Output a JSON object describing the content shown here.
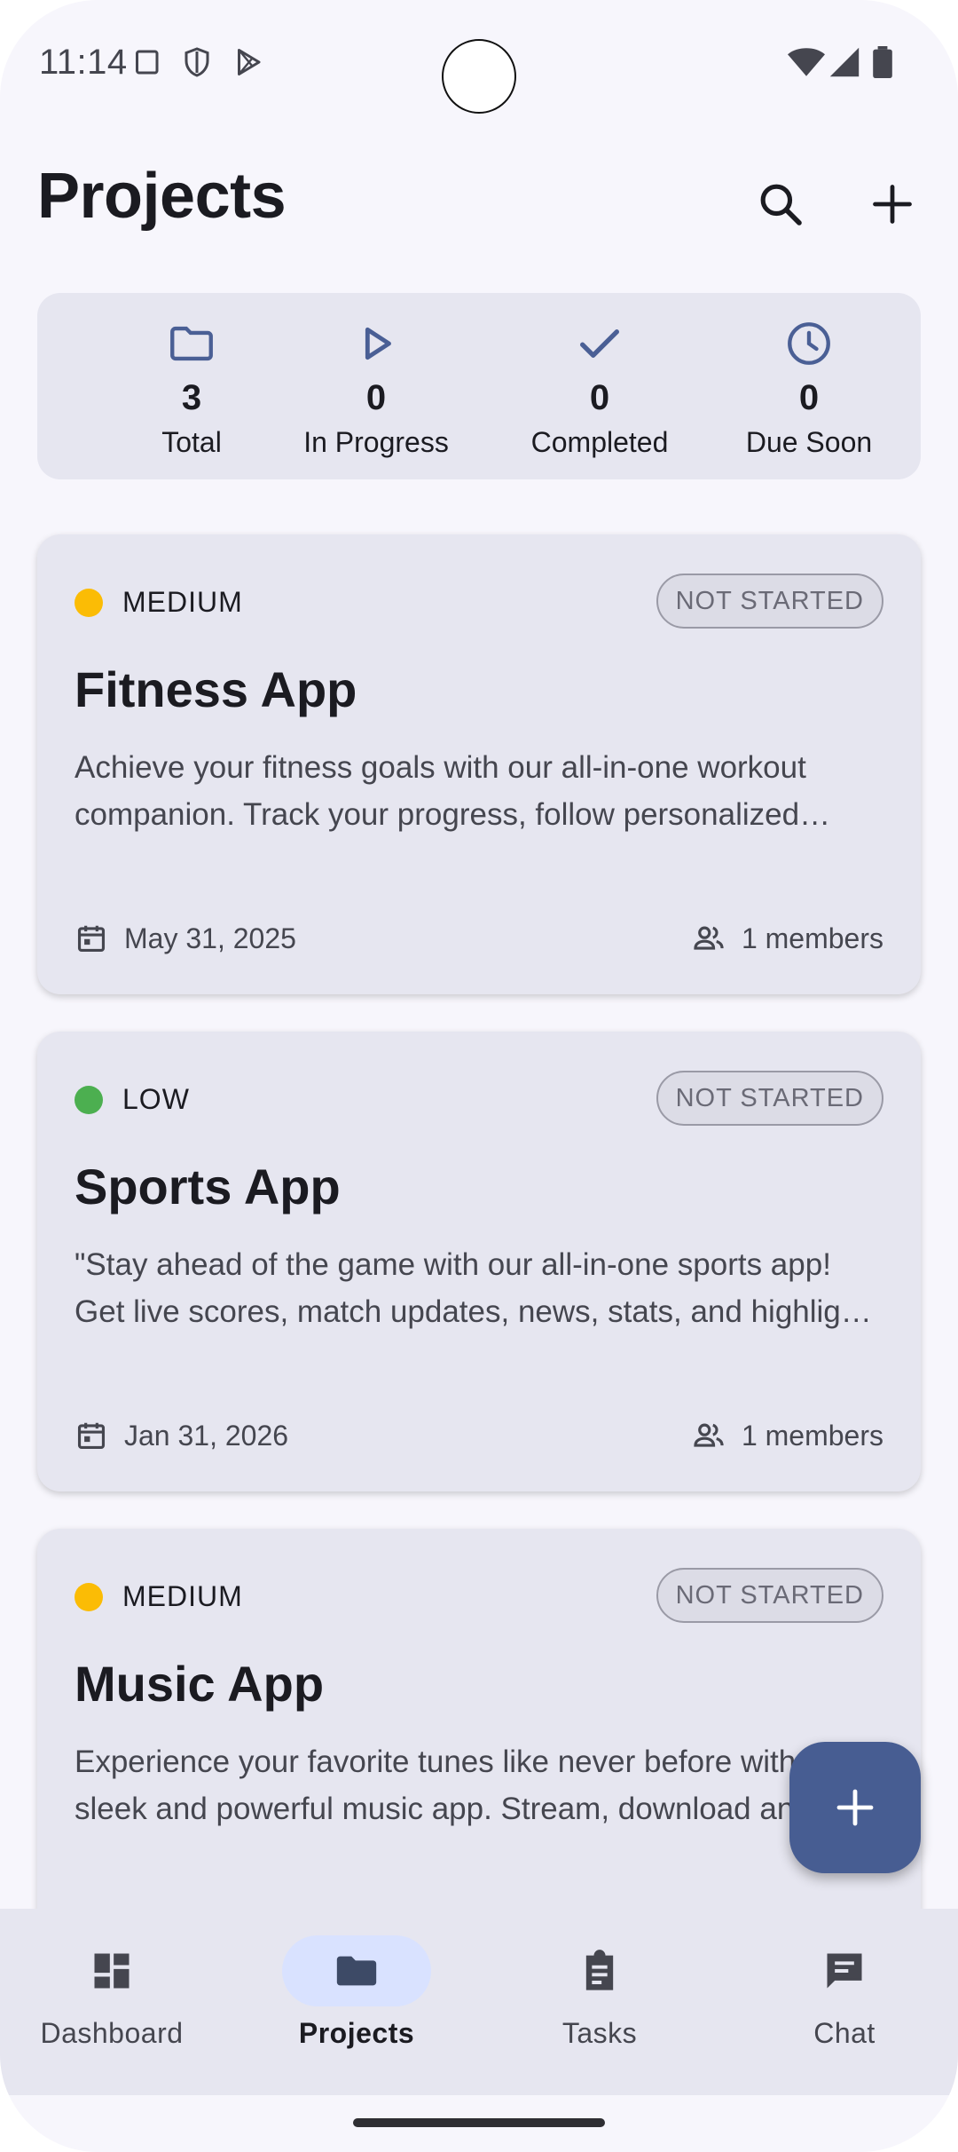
{
  "status_bar": {
    "time": "11:14"
  },
  "header": {
    "title": "Projects"
  },
  "stats": [
    {
      "icon": "folder-icon",
      "value": "3",
      "label": "Total"
    },
    {
      "icon": "play-icon",
      "value": "0",
      "label": "In Progress"
    },
    {
      "icon": "check-icon",
      "value": "0",
      "label": "Completed"
    },
    {
      "icon": "clock-icon",
      "value": "0",
      "label": "Due Soon"
    }
  ],
  "projects": [
    {
      "priority": "MEDIUM",
      "priority_color": "#fbbc05",
      "status": "NOT STARTED",
      "title": "Fitness App",
      "description": "Achieve your fitness goals with our all-in-one workout companion. Track your progress, follow personalized workout plans and stay motivated every day.",
      "date": "May 31, 2025",
      "members": "1 members"
    },
    {
      "priority": "LOW",
      "priority_color": "#4caf50",
      "status": "NOT STARTED",
      "title": "Sports App",
      "description": "\"Stay ahead of the game with our all-in-one sports app! Get live scores, match updates, news, stats, and highlights from your favorite teams.",
      "date": "Jan 31, 2026",
      "members": "1 members"
    },
    {
      "priority": "MEDIUM",
      "priority_color": "#fbbc05",
      "status": "NOT STARTED",
      "title": "Music App",
      "description": "Experience your favorite tunes like never before with our sleek and powerful music app. Stream, download and discover new music.",
      "date": "",
      "members": ""
    }
  ],
  "bottom_nav": [
    {
      "label": "Dashboard",
      "icon": "dashboard-icon",
      "active": false
    },
    {
      "label": "Projects",
      "icon": "folder-icon",
      "active": true
    },
    {
      "label": "Tasks",
      "icon": "clipboard-icon",
      "active": false
    },
    {
      "label": "Chat",
      "icon": "chat-icon",
      "active": false
    }
  ],
  "colors": {
    "accent": "#475d92",
    "icon_blue": "#4a5f95",
    "card_bg": "#e6e6f0",
    "page_bg": "#f7f6fc",
    "nav_active_pill": "#d9e2ff"
  }
}
